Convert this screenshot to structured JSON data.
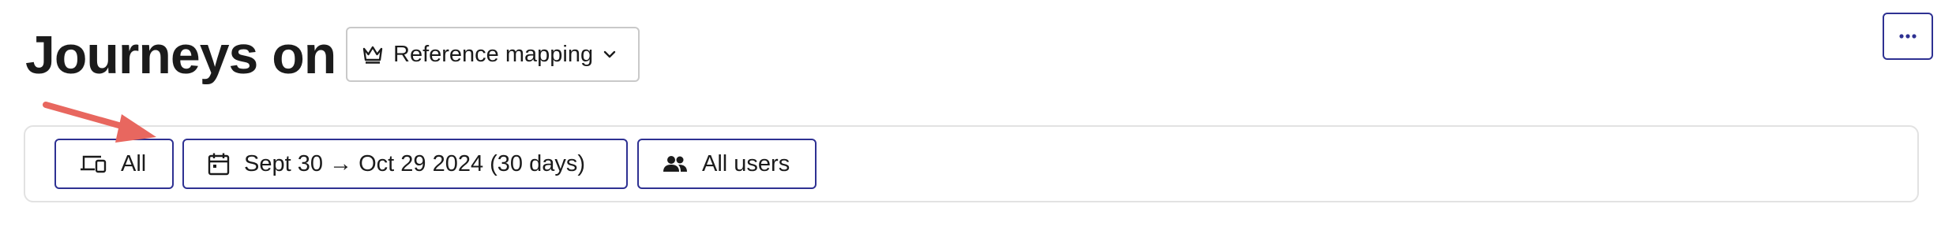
{
  "header": {
    "title": "Journeys on",
    "mapping_select": {
      "icon": "crown-icon",
      "label": "Reference mapping",
      "dropdown_icon": "chevron-down-icon"
    },
    "more_button": {
      "icon": "more-horizontal-icon"
    }
  },
  "filters": [
    {
      "icon": "devices-icon",
      "label": "All"
    },
    {
      "icon": "calendar-icon",
      "label": "Sept 30 → Oct 29 2024 (30 days)"
    },
    {
      "icon": "users-icon",
      "label": "All users"
    }
  ],
  "annotation": {
    "arrow_color": "#e8675f"
  },
  "colors": {
    "accent_border": "#2e3192",
    "neutral_border": "#c9c9c9",
    "panel_border": "#e2e2e2",
    "text": "#1b1b1b"
  }
}
